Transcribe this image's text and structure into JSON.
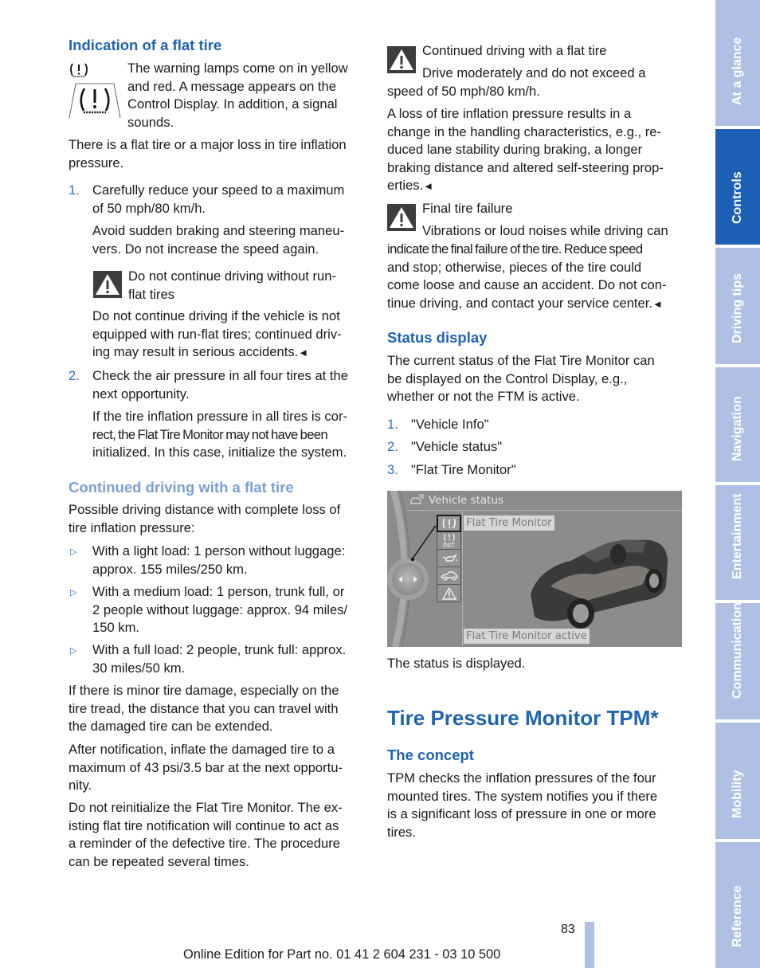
{
  "left": {
    "indication": {
      "heading": "Indication of a flat tire",
      "lamp_text": [
        "The warning lamps come on in yellow",
        "and red. A message appears on the",
        "Control Display. In addition, a signal",
        "sounds."
      ],
      "para": [
        "There is a flat tire or a major loss in tire inflation",
        "pressure."
      ]
    },
    "steps": [
      {
        "num": "1.",
        "lines": [
          "Carefully reduce your speed to a maximum",
          "of 50 mph/80 km/h."
        ],
        "sub": [
          "Avoid sudden braking and steering maneu-",
          "vers. Do not increase the speed again."
        ]
      },
      {
        "num": "2.",
        "lines": [
          "Check the air pressure in all four tires at the",
          "next opportunity."
        ],
        "sub": [
          "If the tire inflation pressure in all tires is cor-",
          "rect, the Flat Tire Monitor may not have been",
          "initialized. In this case, initialize the system."
        ]
      }
    ],
    "warning_runflat": {
      "title": [
        "Do not continue driving without run-",
        "flat tires"
      ],
      "body": [
        "Do not continue driving if the vehicle is not",
        "equipped with run-flat tires; continued driv-",
        "ing may result in serious accidents."
      ],
      "end_mark": "◄"
    },
    "continued": {
      "heading": "Continued driving with a flat tire",
      "intro": [
        "Possible driving distance with complete loss of",
        "tire inflation pressure:"
      ],
      "bullet_glyph": "▷",
      "bullets": [
        [
          "With a light load: 1 person without luggage:",
          "approx. 155 miles/250 km."
        ],
        [
          "With a medium load: 1 person, trunk full, or",
          "2 people without luggage: approx. 94 miles/",
          "150 km."
        ],
        [
          "With a full load: 2 people, trunk full: approx.",
          "30 miles/50 km."
        ]
      ],
      "para_minor": [
        "If there is minor tire damage, especially on the",
        "tire tread, the distance that you can travel with",
        "the damaged tire can be extended."
      ],
      "para_inflate": [
        "After notification, inflate the damaged tire to a",
        "maximum of 43 psi/3.5 bar at the next opportu-",
        "nity."
      ],
      "para_reinit": [
        "Do not reinitialize the Flat Tire Monitor. The ex-",
        "isting flat tire notification will continue to act as",
        "a reminder of the defective tire. The procedure",
        "can be repeated several times."
      ]
    }
  },
  "right": {
    "warning_continued": {
      "title": "Continued driving with a flat tire",
      "body_first": "Drive moderately and do not exceed a",
      "body_rest": "speed of 50 mph/80 km/h."
    },
    "loss_para": [
      "A loss of tire inflation pressure results in a",
      "change in the handling characteristics, e.g., re-",
      "duced lane stability during braking, a longer",
      "braking distance and altered self-steering prop-",
      "erties."
    ],
    "end_mark": "◄",
    "warning_final": {
      "title": "Final tire failure",
      "body_first": "Vibrations or loud noises while driving can",
      "body_rest": [
        "indicate the final failure of the tire. Reduce speed",
        "and stop; otherwise, pieces of the tire could",
        "come loose and cause an accident. Do not con-",
        "tinue driving, and contact your service center."
      ]
    },
    "status": {
      "heading": "Status display",
      "para": [
        "The current status of the Flat Tire Monitor can",
        "be displayed on the Control Display, e.g.,",
        "whether or not the FTM is active."
      ],
      "steps": [
        {
          "num": "1.",
          "text": "\"Vehicle Info\""
        },
        {
          "num": "2.",
          "text": "\"Vehicle status\""
        },
        {
          "num": "3.",
          "text": "\"Flat Tire Monitor\""
        }
      ],
      "screen": {
        "title": "Vehicle status",
        "selected_label": "Flat Tire Monitor",
        "status_label": "Flat Tire Monitor active",
        "menu_icons": [
          "flat-tire-monitor-icon",
          "flat-tire-init-icon",
          "oil-level-icon",
          "car-icon",
          "warning-icon"
        ],
        "init_text": "INIT"
      },
      "caption": "The status is displayed."
    },
    "tpm": {
      "title": "Tire Pressure Monitor TPM*",
      "concept_heading": "The concept",
      "concept_para": [
        "TPM checks the inflation pressures of the four",
        "mounted tires. The system notifies you if there",
        "is a significant loss of pressure in one or more",
        "tires."
      ]
    }
  },
  "side_tabs": [
    {
      "label": "At a glance",
      "active": false
    },
    {
      "label": "Controls",
      "active": true
    },
    {
      "label": "Driving tips",
      "active": false
    },
    {
      "label": "Navigation",
      "active": false
    },
    {
      "label": "Entertainment",
      "active": false
    },
    {
      "label": "Communication",
      "active": false
    },
    {
      "label": "Mobility",
      "active": false
    },
    {
      "label": "Reference",
      "active": false
    }
  ],
  "footer": {
    "page_number": "83",
    "edition": "Online Edition for Part no. 01 41 2 604 231 - 03 10 500"
  },
  "colors": {
    "heading_blue": "#1f63b3",
    "heading_light_blue": "#7aa0d8",
    "tab_inactive": "#b0c0e4",
    "tab_active": "#1c5fb4"
  }
}
